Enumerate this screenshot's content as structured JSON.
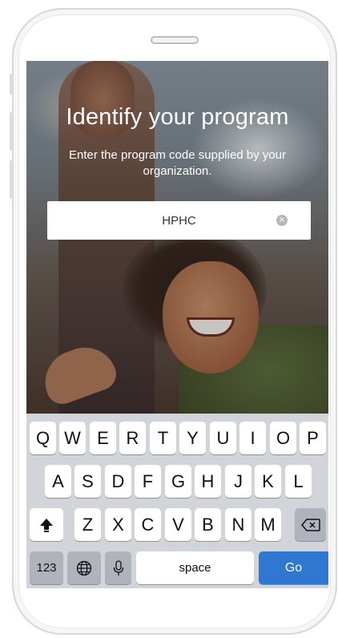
{
  "screen": {
    "title": "Identify your program",
    "subtitle": "Enter the program code supplied by your organization.",
    "code_value": "HPHC",
    "clear_symbol": "×"
  },
  "keyboard": {
    "row1": [
      "Q",
      "W",
      "E",
      "R",
      "T",
      "Y",
      "U",
      "I",
      "O",
      "P"
    ],
    "row2": [
      "A",
      "S",
      "D",
      "F",
      "G",
      "H",
      "J",
      "K",
      "L"
    ],
    "row3": [
      "Z",
      "X",
      "C",
      "V",
      "B",
      "N",
      "M"
    ],
    "numbers_label": "123",
    "space_label": "space",
    "go_label": "Go",
    "icons": {
      "shift": "shift-arrow-icon",
      "backspace": "backspace-icon",
      "globe": "globe-icon",
      "mic": "microphone-icon"
    }
  },
  "colors": {
    "go_key": "#2f77d0",
    "keyboard_bg": "#d1d4d9",
    "key_dark": "#aeb3bc"
  }
}
